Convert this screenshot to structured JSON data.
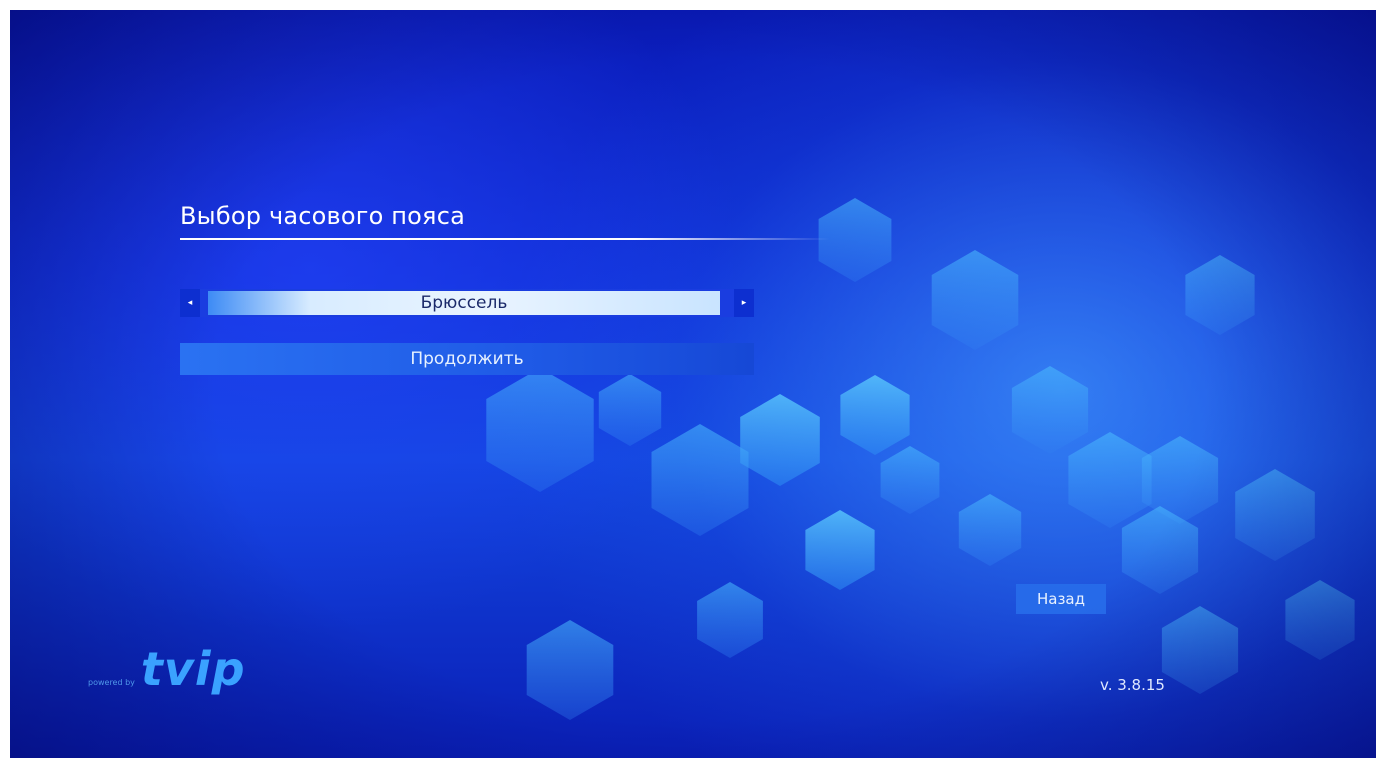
{
  "screen": {
    "title": "Выбор часового пояса",
    "timezone_selector": {
      "value": "Брюссель",
      "prev_arrow": "◂",
      "next_arrow": "▸"
    },
    "continue_label": "Продолжить",
    "back_label": "Назад",
    "version": "v. 3.8.15"
  },
  "branding": {
    "powered_by": "powered by",
    "logo": "tvip"
  },
  "colors": {
    "background": "#0f2fd6",
    "accent_hex": "#3aa2ff",
    "field_highlight": "#e9f4ff"
  }
}
